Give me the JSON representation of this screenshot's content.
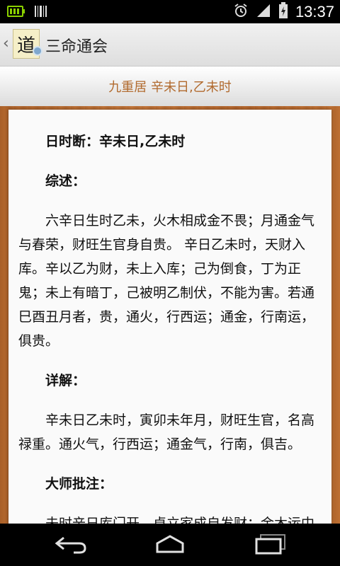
{
  "status_bar": {
    "time": "13:37",
    "icons": [
      "battery-full-icon",
      "barcode-icon",
      "alarm-icon",
      "signal-icon",
      "charging-battery-icon"
    ]
  },
  "action_bar": {
    "logo_glyph": "道",
    "title": "三命通会"
  },
  "subheader": {
    "title": "九重居 辛未日,乙未时"
  },
  "article": {
    "paragraphs": [
      {
        "text": "日时断：辛未日,乙未时",
        "heading": true
      },
      {
        "text": "综述：",
        "heading": true
      },
      {
        "text": "六辛日生时乙未，火木相成金不畏；月通金气与春荣，财旺生官身自贵。 辛日乙未时，天财入库。辛以乙为财，未上入库；己为倒食，丁为正鬼；未上有暗丁，己被明乙制伏，不能为害。若通巳酉丑月者，贵，通火，行西运；通金，行南运，俱贵。",
        "heading": false
      },
      {
        "text": "详解：",
        "heading": true
      },
      {
        "text": "辛未日乙未时，寅卯未年月，财旺生官，名高禄重。通火气，行西运；通金气，行南，俱吉。",
        "heading": false
      },
      {
        "text": "大师批注：",
        "heading": true
      },
      {
        "text": "未时辛日库门开，卓立家成自发财；金木运中身旺吉，几经险遇福重来。辛日时逢乙未，库中透",
        "heading": false
      }
    ]
  },
  "nav_bar": {
    "buttons": [
      "back-icon",
      "home-icon",
      "recent-apps-icon"
    ]
  }
}
